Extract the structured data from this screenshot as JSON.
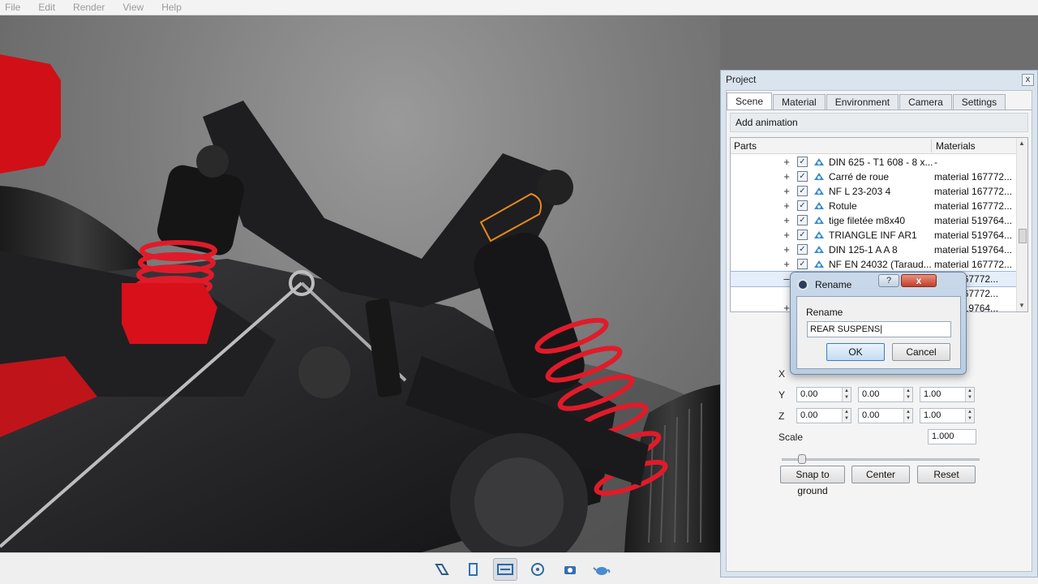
{
  "menu": [
    "File",
    "Edit",
    "Render",
    "View",
    "Help"
  ],
  "toolbar": {
    "icons": [
      "scene-tree-icon",
      "book-icon",
      "render-region-icon",
      "camera-target-icon",
      "camera-icon",
      "teapot-icon"
    ],
    "active": "render-region-icon"
  },
  "project": {
    "title": "Project",
    "close": "x",
    "tabs": [
      "Scene",
      "Material",
      "Environment",
      "Camera",
      "Settings"
    ],
    "active_tab": "Scene",
    "add_animation": "Add animation",
    "tree": {
      "col_parts": "Parts",
      "col_materials": "Materials",
      "rows": [
        {
          "name": "DIN 625 - T1 608 - 8 x...",
          "material": "-"
        },
        {
          "name": "Carré de roue",
          "material": "material 167772..."
        },
        {
          "name": "NF L 23-203 4",
          "material": "material 167772..."
        },
        {
          "name": "Rotule",
          "material": "material 167772..."
        },
        {
          "name": "tige filetée m8x40",
          "material": "material 519764..."
        },
        {
          "name": "TRIANGLE INF AR1",
          "material": "material 519764..."
        },
        {
          "name": "DIN 125-1  A A 8",
          "material": "material 519764..."
        },
        {
          "name": "NF EN 24032  (Taraud...",
          "material": "material 167772..."
        },
        {
          "name": "",
          "material": "167772..."
        },
        {
          "name": "",
          "material": "167772..."
        },
        {
          "name": "",
          "material": "519764..."
        }
      ]
    },
    "transform": {
      "x_label": "X",
      "y_label": "Y",
      "z_label": "Z",
      "y_values": [
        "0.00",
        "0.00",
        "1.00"
      ],
      "z_values": [
        "0.00",
        "0.00",
        "1.00"
      ],
      "scale_label": "Scale",
      "scale_value": "1.000",
      "scale_slider_fraction": 0.12
    },
    "buttons": {
      "snap": "Snap to ground",
      "center": "Center",
      "reset": "Reset"
    }
  },
  "rename_dialog": {
    "title": "Rename",
    "help": "?",
    "close": "x",
    "label": "Rename",
    "value": "REAR SUSPENS|",
    "ok": "OK",
    "cancel": "Cancel"
  },
  "colors": {
    "spring": "#e01b2a",
    "chassis": "#1c1c1e",
    "ground": "#7a7a7a",
    "selection_outline": "#e58a1c"
  }
}
